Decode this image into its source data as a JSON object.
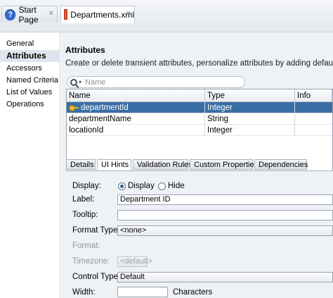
{
  "tabs": [
    {
      "label": "Start Page",
      "icon": "help-icon",
      "active": false
    },
    {
      "label": "Departments.xml",
      "icon": "xml-file-icon",
      "active": true
    }
  ],
  "nav": {
    "items": [
      "General",
      "Attributes",
      "Accessors",
      "Named Criteria",
      "List of Values",
      "Operations"
    ],
    "selected": "Attributes"
  },
  "section": {
    "title": "Attributes",
    "description": "Create or delete transient attributes, personalize attributes by adding default values, UI hin"
  },
  "search": {
    "placeholder": "Name"
  },
  "table": {
    "columns": [
      "Name",
      "Type",
      "Info"
    ],
    "rows": [
      {
        "name": "departmentId",
        "type": "Integer",
        "key": true,
        "selected": true
      },
      {
        "name": "departmentName",
        "type": "String",
        "key": false,
        "selected": false
      },
      {
        "name": "locationId",
        "type": "Integer",
        "key": false,
        "selected": false
      }
    ]
  },
  "subtabs": [
    "Details",
    "UI Hints",
    "Validation Rules",
    "Custom Properties",
    "Dependencies"
  ],
  "active_subtab": "UI Hints",
  "form": {
    "display_label": "Display:",
    "display_option": "Display",
    "hide_option": "Hide",
    "display_selected": "Display",
    "label_label": "Label:",
    "label_value": "Department ID",
    "tooltip_label": "Tooltip:",
    "tooltip_value": "",
    "format_type_label": "Format Type:",
    "format_type_value": "<none>",
    "format_label": "Format:",
    "timezone_label": "Timezone:",
    "timezone_value": "<default>",
    "control_type_label": "Control Type:",
    "control_type_value": "Default",
    "width_label": "Width:",
    "width_value": "",
    "characters_label": "Characters"
  }
}
